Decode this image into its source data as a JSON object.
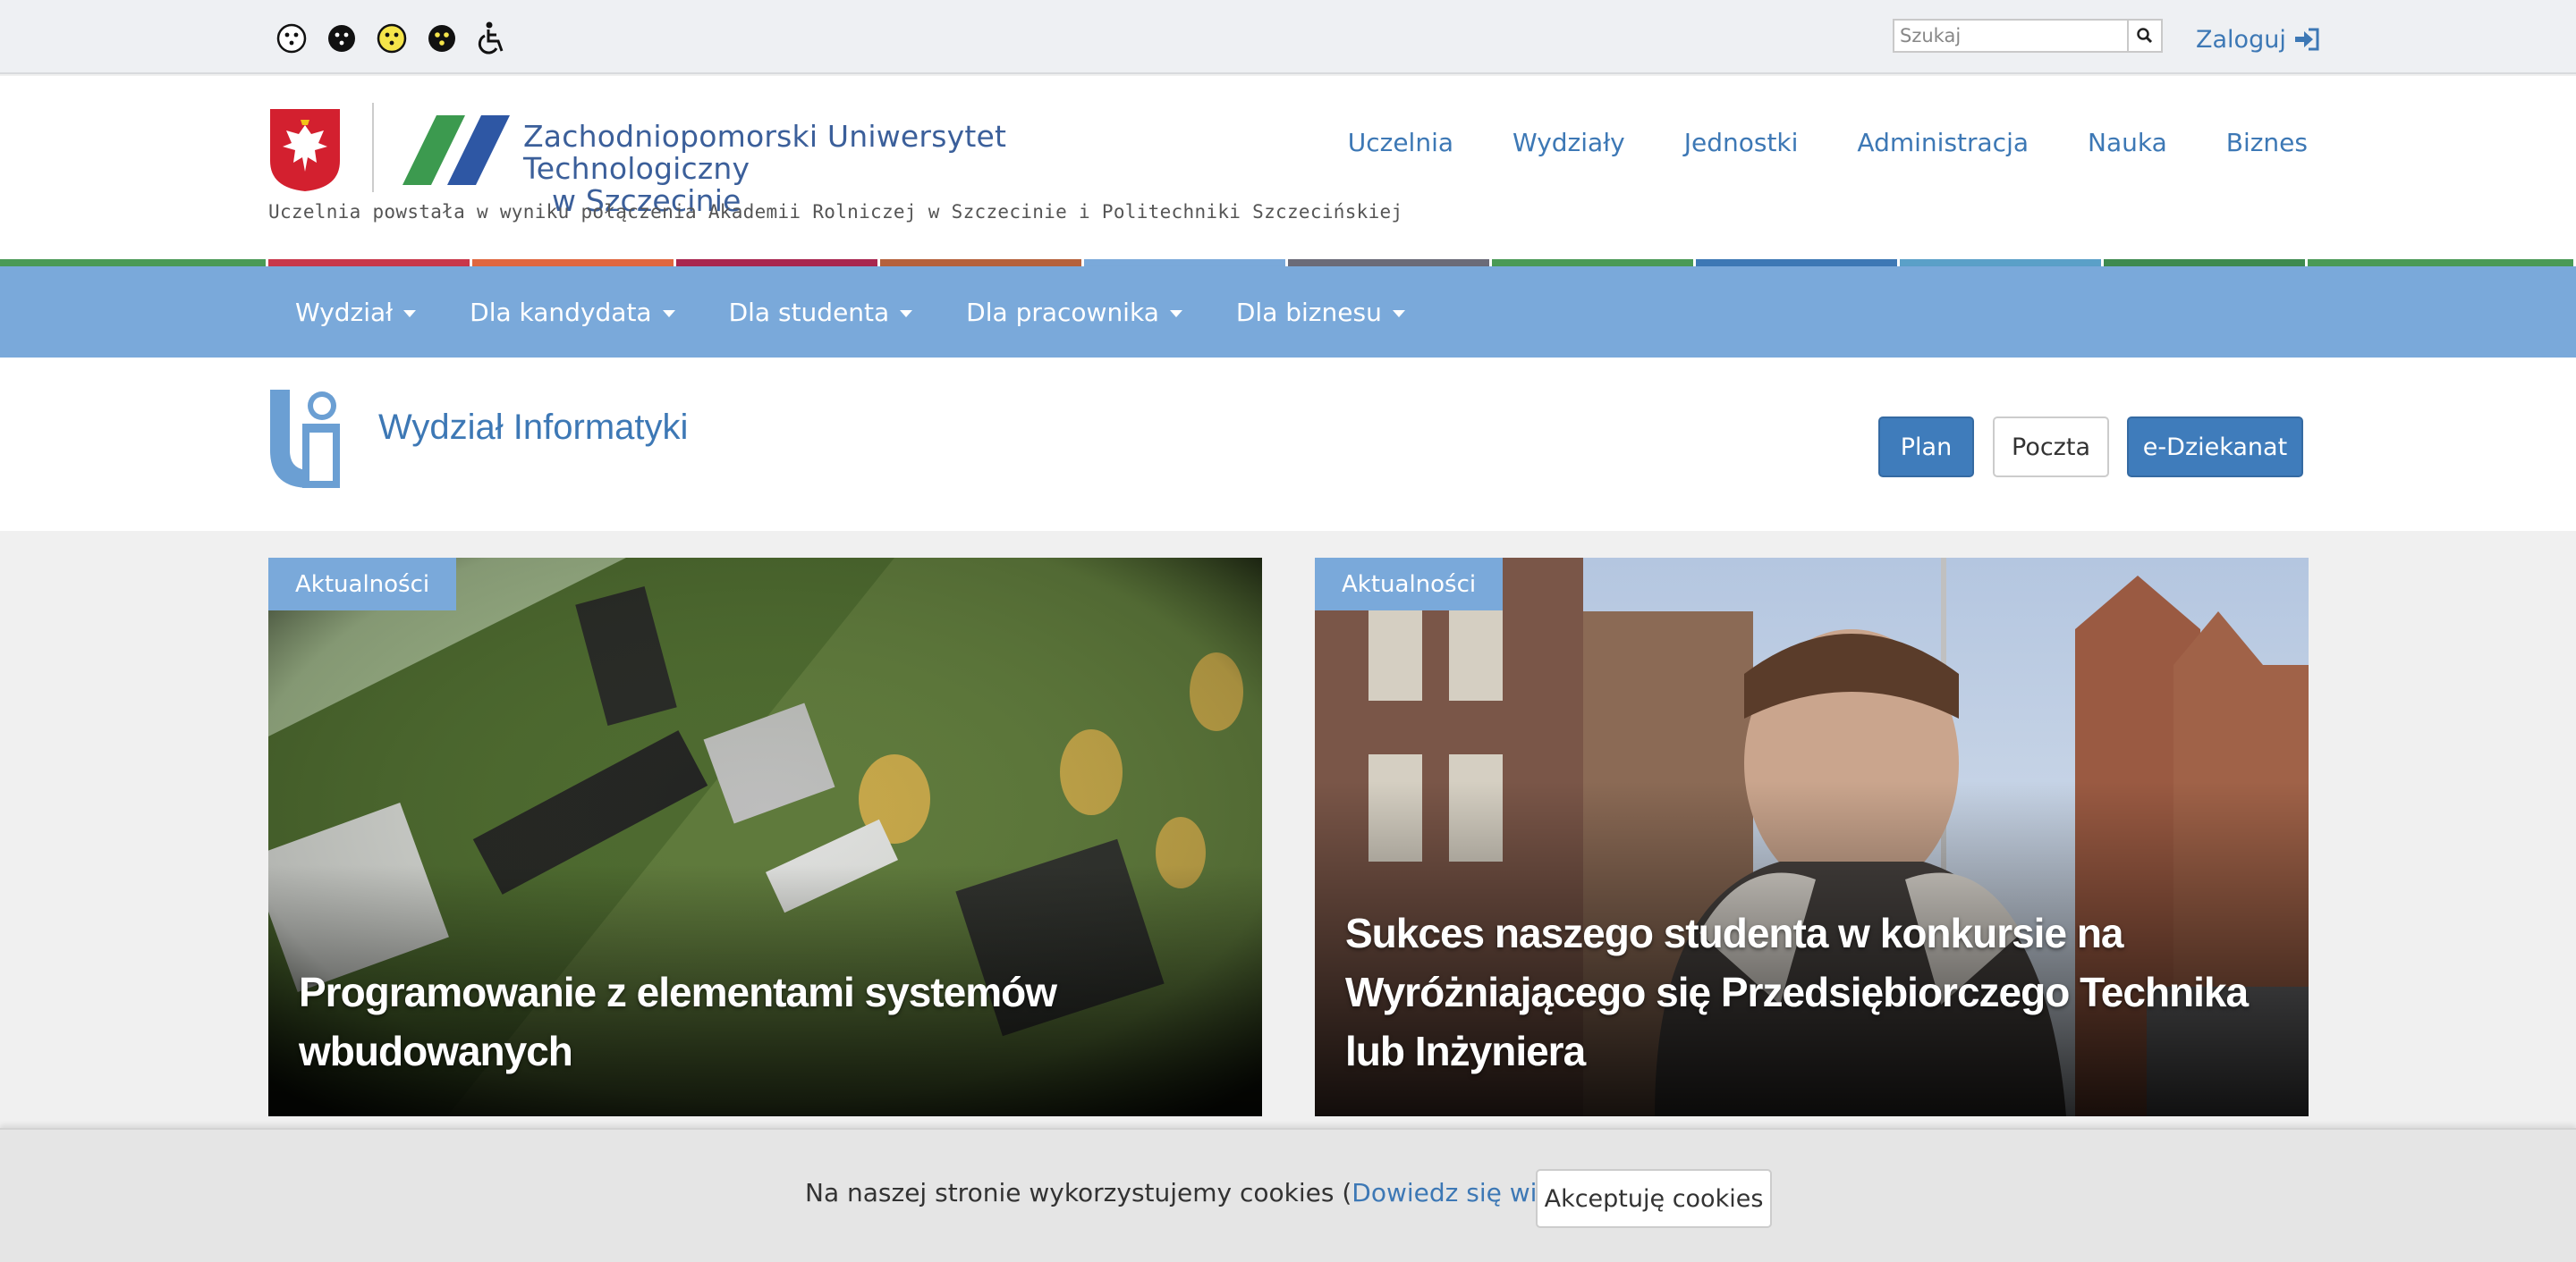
{
  "topbar": {
    "a11y_buttons": [
      "contrast-default-icon",
      "contrast-black-white-icon",
      "contrast-yellow-black-icon",
      "contrast-black-yellow-icon",
      "wheelchair-icon"
    ],
    "search": {
      "placeholder": "Szukaj",
      "value": ""
    },
    "login_label": "Zaloguj"
  },
  "header": {
    "university_name_line1": "Zachodniopomorski Uniwersytet Technologiczny",
    "university_name_line2": "w Szczecinie",
    "tagline": "Uczelnia powstała w wyniku połączenia Akademii Rolniczej w Szczecinie i Politechniki Szczecińskiej",
    "nav": [
      "Uczelnia",
      "Wydziały",
      "Jednostki",
      "Administracja",
      "Nauka",
      "Biznes"
    ]
  },
  "strip_colors": [
    "#4a9a55",
    "#c8374a",
    "#e0673f",
    "#a8264f",
    "#b5613b",
    "#7aa9da",
    "#6b6b78",
    "#4a9a55",
    "#3d78b5",
    "#5aa0c8",
    "#3e8a4f",
    "#4a9a55"
  ],
  "menu": [
    "Wydział",
    "Dla kandydata",
    "Dla studenta",
    "Dla pracownika",
    "Dla biznesu"
  ],
  "faculty": {
    "title": "Wydział Informatyki",
    "buttons": {
      "plan": "Plan",
      "poczta": "Poczta",
      "edziekanat": "e-Dziekanat"
    }
  },
  "news": [
    {
      "tag": "Aktualności",
      "title": "Programowanie z elementami systemów wbudowanych"
    },
    {
      "tag": "Aktualności",
      "title": "Sukces naszego studenta w konkursie na Wyróżniającego się Przedsiębiorczego Technika lub Inżyniera"
    }
  ],
  "cookie": {
    "text_before": "Na naszej stronie wykorzystujemy cookies (",
    "link": "Dowiedz się więcej",
    "text_after": ")",
    "accept": "Akceptuję cookies"
  },
  "colors": {
    "accent": "#3d78b5",
    "menubar": "#7aa9da",
    "button_primary": "#3f7cbb"
  }
}
